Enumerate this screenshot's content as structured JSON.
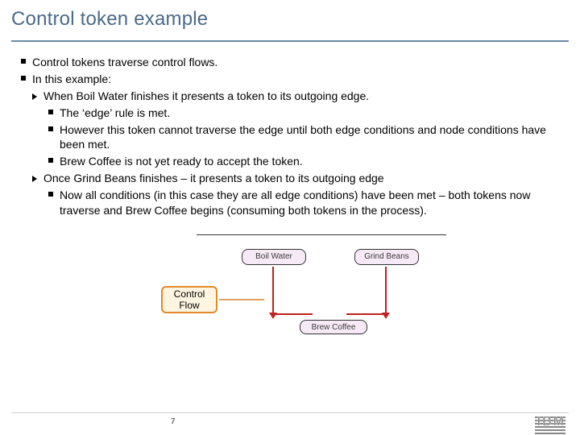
{
  "title": "Control token example",
  "bullets": {
    "p1": "Control tokens traverse control flows.",
    "p2": "In this example:",
    "sub1": "When Boil Water finishes it presents a token to its outgoing edge.",
    "sub1a": "The ‘edge’ rule is met.",
    "sub1b": "However this token cannot traverse the edge until both edge conditions and node conditions have been met.",
    "sub1c": "Brew Coffee is not yet ready to accept the token.",
    "sub2": "Once Grind Beans finishes – it presents a token to its outgoing edge",
    "sub2a": "Now all conditions (in this case they are all edge conditions) have been met – both tokens now traverse and Brew Coffee begins (consuming both tokens in the process)."
  },
  "diagram": {
    "boil": "Boil Water",
    "grind": "Grind Beans",
    "brew": "Brew Coffee",
    "callout": "Control Flow"
  },
  "footer": {
    "page": "7",
    "logo": "IBM"
  }
}
